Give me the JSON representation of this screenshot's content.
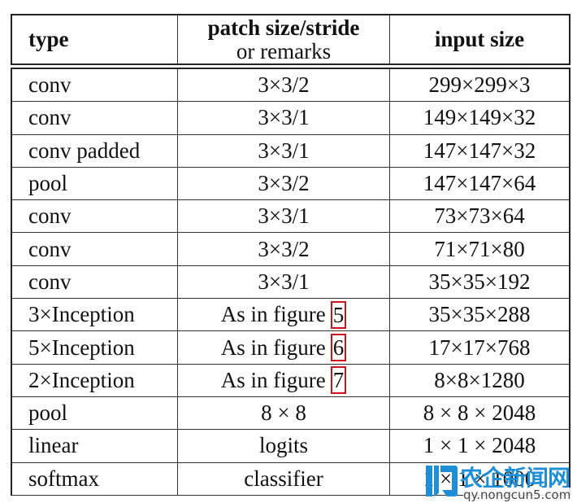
{
  "header": {
    "type": "type",
    "patch_line1": "patch size/stride",
    "patch_line2": "or remarks",
    "input": "input size"
  },
  "rows": [
    {
      "type": "conv",
      "patch": "3×3/2",
      "input": "299×299×3"
    },
    {
      "type": "conv",
      "patch": "3×3/1",
      "input": "149×149×32"
    },
    {
      "type": "conv padded",
      "patch": "3×3/1",
      "input": "147×147×32"
    },
    {
      "type": "pool",
      "patch": "3×3/2",
      "input": "147×147×64"
    },
    {
      "type": "conv",
      "patch": "3×3/1",
      "input": "73×73×64"
    },
    {
      "type": "conv",
      "patch": "3×3/2",
      "input": "71×71×80"
    },
    {
      "type": "conv",
      "patch": "3×3/1",
      "input": "35×35×192"
    },
    {
      "type": "3×Inception",
      "patch": "As in figure",
      "ref": "5",
      "input": "35×35×288"
    },
    {
      "type": "5×Inception",
      "patch": "As in figure",
      "ref": "6",
      "input": "17×17×768"
    },
    {
      "type": "2×Inception",
      "patch": "As in figure",
      "ref": "7",
      "input": "8×8×1280"
    },
    {
      "type": "pool",
      "patch": "8 × 8",
      "input": "8 × 8 × 2048"
    },
    {
      "type": "linear",
      "patch": "logits",
      "input": "1 × 1 × 2048"
    },
    {
      "type": "softmax",
      "patch": "classifier",
      "input": "1 × 1 × 1000"
    }
  ],
  "colors": {
    "ref_box": "#c8141e",
    "watermark": "#1e8fd6"
  },
  "watermark": {
    "name": "农企新闻网",
    "url": "qy.nongcun5.com"
  }
}
